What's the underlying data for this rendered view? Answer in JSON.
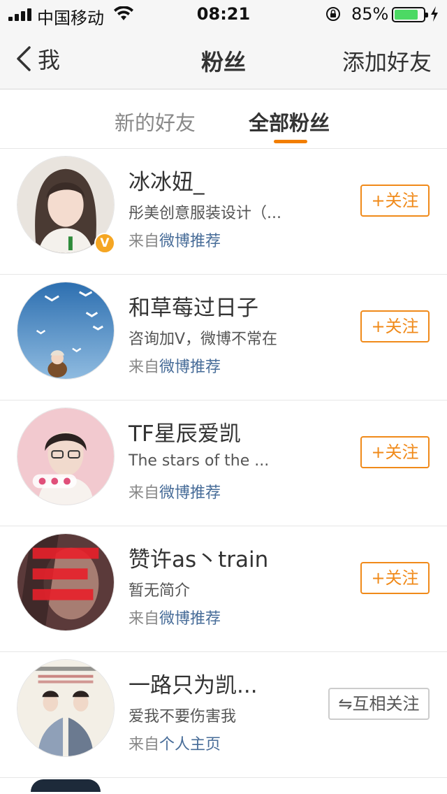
{
  "status_bar": {
    "carrier": "中国移动",
    "time": "08:21",
    "battery_percent": "85%",
    "battery_level": 0.85
  },
  "nav": {
    "back_label": "我",
    "title": "粉丝",
    "add_friend_label": "添加好友"
  },
  "tabs": {
    "new_friends": "新的好友",
    "all_fans": "全部粉丝",
    "active": "all_fans"
  },
  "colors": {
    "accent": "#f27e00",
    "link": "#476c98",
    "verified": "#f5a623",
    "battery": "#4cd964"
  },
  "fans": [
    {
      "name": "冰冰妞_",
      "bio": "彤美创意服装设计（...",
      "source_prefix": "来自",
      "source_link": "微博推荐",
      "button": "+关注",
      "button_type": "follow",
      "verified": true,
      "verified_badge": "V",
      "avatar_icon": "girl-portrait"
    },
    {
      "name": "和草莓过日子",
      "bio": "咨询加V，微博不常在",
      "source_prefix": "来自",
      "source_link": "微博推荐",
      "button": "+关注",
      "button_type": "follow",
      "verified": false,
      "avatar_icon": "seagulls-sky"
    },
    {
      "name": "TF星辰爱凯",
      "bio": "The  stars  of  the  ...",
      "source_prefix": "来自",
      "source_link": "微博推荐",
      "button": "+关注",
      "button_type": "follow",
      "verified": false,
      "avatar_icon": "boy-portrait"
    },
    {
      "name": "赞许as丶train",
      "bio": "暂无简介",
      "source_prefix": "来自",
      "source_link": "微博推荐",
      "button": "+关注",
      "button_type": "follow",
      "verified": false,
      "avatar_icon": "red-text-face"
    },
    {
      "name": "一路只为凯...",
      "bio": "爱我不要伤害我",
      "source_prefix": "来自",
      "source_link": "个人主页",
      "button": "⇋互相关注",
      "button_type": "mutual",
      "verified": false,
      "avatar_icon": "tfboys-poster"
    }
  ]
}
